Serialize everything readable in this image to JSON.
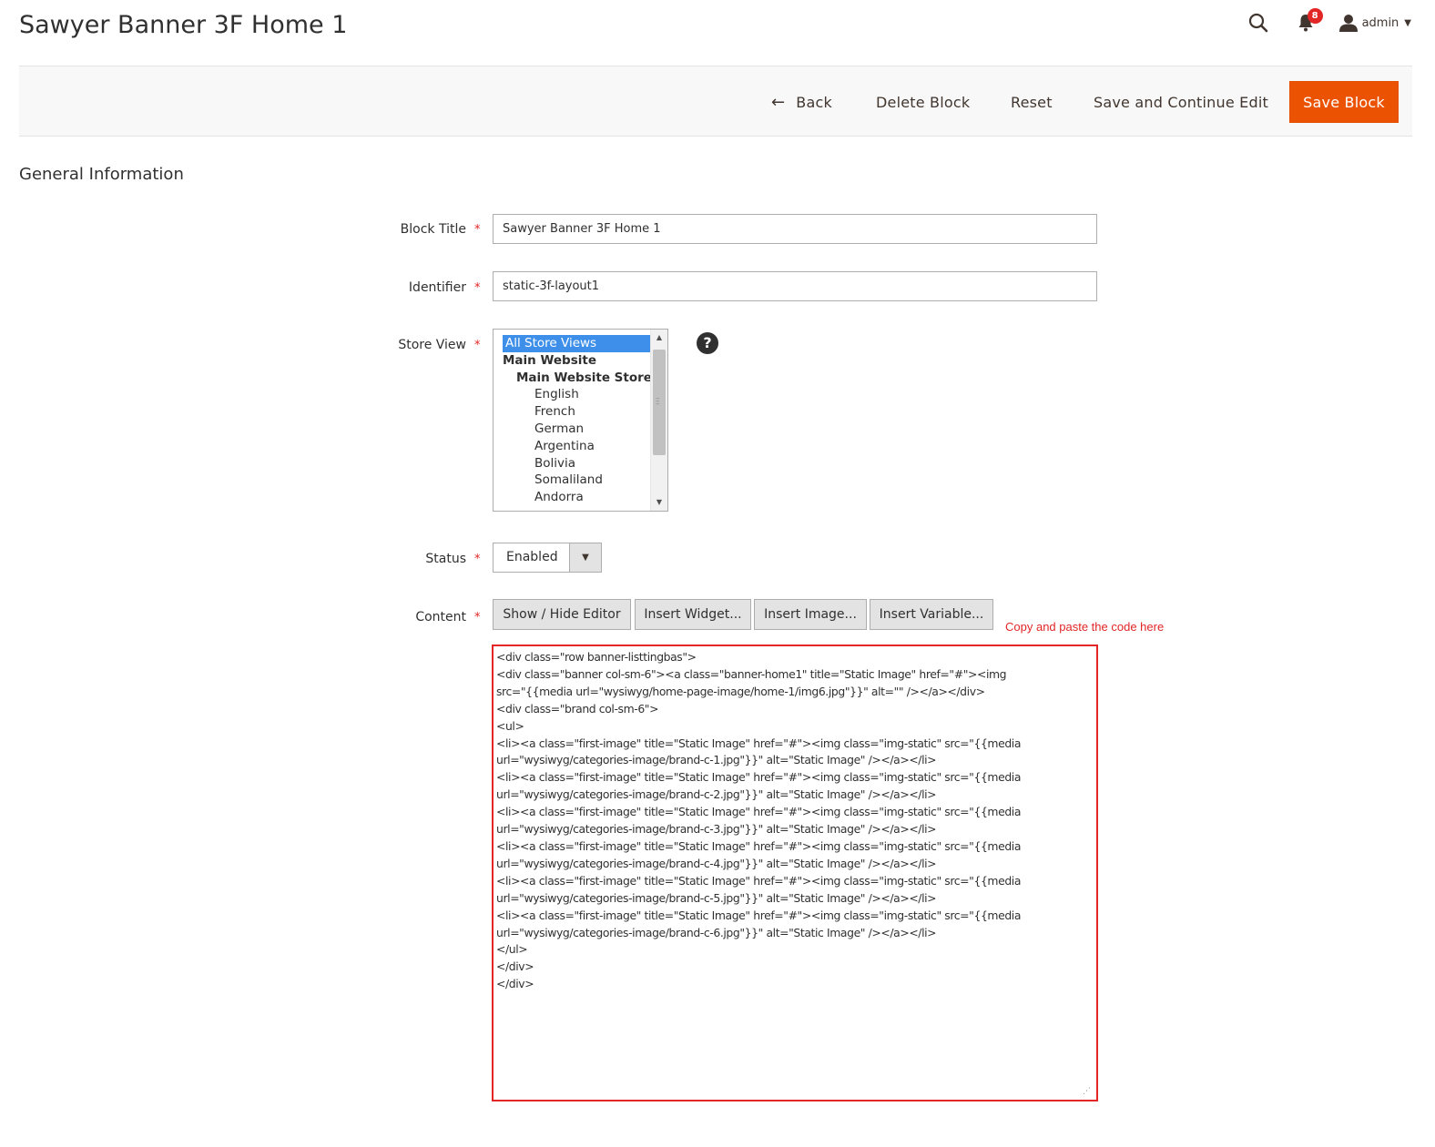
{
  "header": {
    "title": "Sawyer Banner 3F Home 1",
    "notifications_count": "8",
    "user_label": "admin"
  },
  "actions": {
    "back": "Back",
    "delete": "Delete Block",
    "reset": "Reset",
    "save_continue": "Save and Continue Edit",
    "save": "Save Block"
  },
  "section": {
    "title": "General Information"
  },
  "form": {
    "block_title": {
      "label": "Block Title",
      "value": "Sawyer Banner 3F Home 1"
    },
    "identifier": {
      "label": "Identifier",
      "value": "static-3f-layout1"
    },
    "store_view": {
      "label": "Store View",
      "options": [
        {
          "label": "All Store Views",
          "level": 0,
          "selected": true,
          "group": false
        },
        {
          "label": "Main Website",
          "level": 0,
          "selected": false,
          "group": true
        },
        {
          "label": "Main Website Store",
          "level": 1,
          "selected": false,
          "group": true
        },
        {
          "label": "English",
          "level": 2,
          "selected": false,
          "group": false
        },
        {
          "label": "French",
          "level": 2,
          "selected": false,
          "group": false
        },
        {
          "label": "German",
          "level": 2,
          "selected": false,
          "group": false
        },
        {
          "label": "Argentina",
          "level": 2,
          "selected": false,
          "group": false
        },
        {
          "label": "Bolivia",
          "level": 2,
          "selected": false,
          "group": false
        },
        {
          "label": "Somaliland",
          "level": 2,
          "selected": false,
          "group": false
        },
        {
          "label": "Andorra",
          "level": 2,
          "selected": false,
          "group": false
        }
      ]
    },
    "status": {
      "label": "Status",
      "value": "Enabled"
    },
    "content": {
      "label": "Content",
      "buttons": {
        "show_hide": "Show / Hide Editor",
        "insert_widget": "Insert Widget...",
        "insert_image": "Insert Image...",
        "insert_variable": "Insert Variable..."
      },
      "annotation": "Copy and paste the code here",
      "value": "<div class=\"row banner-listtingbas\">\n<div class=\"banner col-sm-6\"><a class=\"banner-home1\" title=\"Static Image\" href=\"#\"><img\nsrc=\"{{media url=\"wysiwyg/home-page-image/home-1/img6.jpg\"}}\" alt=\"\" /></a></div>\n<div class=\"brand col-sm-6\">\n<ul>\n<li><a class=\"first-image\" title=\"Static Image\" href=\"#\"><img class=\"img-static\" src=\"{{media\nurl=\"wysiwyg/categories-image/brand-c-1.jpg\"}}\" alt=\"Static Image\" /></a></li>\n<li><a class=\"first-image\" title=\"Static Image\" href=\"#\"><img class=\"img-static\" src=\"{{media\nurl=\"wysiwyg/categories-image/brand-c-2.jpg\"}}\" alt=\"Static Image\" /></a></li>\n<li><a class=\"first-image\" title=\"Static Image\" href=\"#\"><img class=\"img-static\" src=\"{{media\nurl=\"wysiwyg/categories-image/brand-c-3.jpg\"}}\" alt=\"Static Image\" /></a></li>\n<li><a class=\"first-image\" title=\"Static Image\" href=\"#\"><img class=\"img-static\" src=\"{{media\nurl=\"wysiwyg/categories-image/brand-c-4.jpg\"}}\" alt=\"Static Image\" /></a></li>\n<li><a class=\"first-image\" title=\"Static Image\" href=\"#\"><img class=\"img-static\" src=\"{{media\nurl=\"wysiwyg/categories-image/brand-c-5.jpg\"}}\" alt=\"Static Image\" /></a></li>\n<li><a class=\"first-image\" title=\"Static Image\" href=\"#\"><img class=\"img-static\" src=\"{{media\nurl=\"wysiwyg/categories-image/brand-c-6.jpg\"}}\" alt=\"Static Image\" /></a></li>\n</ul>\n</div>\n</div>"
    }
  },
  "colors": {
    "accent": "#eb5202",
    "annotation": "#e22626",
    "selection": "#3d8fea"
  },
  "icons": {
    "search": "search-icon",
    "notifications": "bell-icon",
    "user": "user-icon",
    "help": "help-icon",
    "back": "arrow-left-icon"
  }
}
